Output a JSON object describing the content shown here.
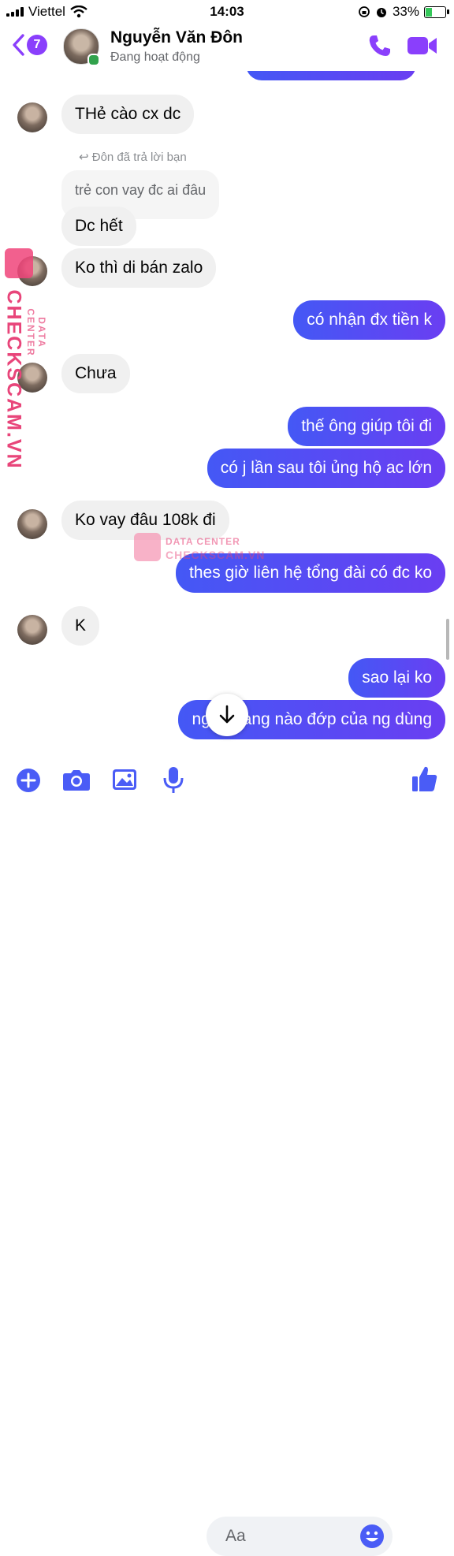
{
  "status_bar": {
    "carrier": "Viettel",
    "time": "14:03",
    "battery": "33%",
    "battery_level": 0.33
  },
  "header": {
    "back_count": "7",
    "name": "Nguyễn Văn Đôn",
    "status": "Đang hoạt động",
    "call_icon": "phone-icon",
    "video_icon": "video-camera-icon"
  },
  "messages": [
    {
      "side": "in",
      "text": "THẻ cào cx dc"
    },
    {
      "side": "reply_label",
      "text": "Đôn đã trả lời bạn"
    },
    {
      "side": "reply_quote",
      "text": "trẻ con vay đc ai đâu"
    },
    {
      "side": "in",
      "text": "Dc hết"
    },
    {
      "side": "in",
      "text": "Ko thì di bán zalo"
    },
    {
      "side": "out",
      "text": "có nhận đx tiền k"
    },
    {
      "side": "in",
      "text": "Chưa"
    },
    {
      "side": "out",
      "text": "thế ông giúp tôi đi"
    },
    {
      "side": "out",
      "text": "có j lần sau tôi ủng hộ ac lớn"
    },
    {
      "side": "in",
      "text": "Ko vay đâu 108k đi"
    },
    {
      "side": "out",
      "text": "thes giờ liên hệ tổng đài có đc ko"
    },
    {
      "side": "in",
      "text": "K"
    },
    {
      "side": "out",
      "text": "sao lại ko"
    },
    {
      "side": "out",
      "text": "ngân hàng nào đớp của ng dùng"
    }
  ],
  "watermark": {
    "vertical_main": "CHECKSCAM.VN",
    "vertical_sub": "DATA CENTER",
    "center_top": "DATA CENTER",
    "center_bottom": "CHECKSCAM.VN"
  },
  "composer": {
    "placeholder": "Aa",
    "icons": [
      "plus-icon",
      "camera-icon",
      "image-icon",
      "microphone-icon",
      "emoji-icon",
      "thumbs-up-icon"
    ]
  },
  "colors": {
    "accent": "#8a3ffc",
    "outgoing_start": "#4458f5",
    "outgoing_end": "#6a3ef2",
    "incoming": "#f0f0f0",
    "watermark": "#e8457a",
    "online": "#31a24c"
  }
}
